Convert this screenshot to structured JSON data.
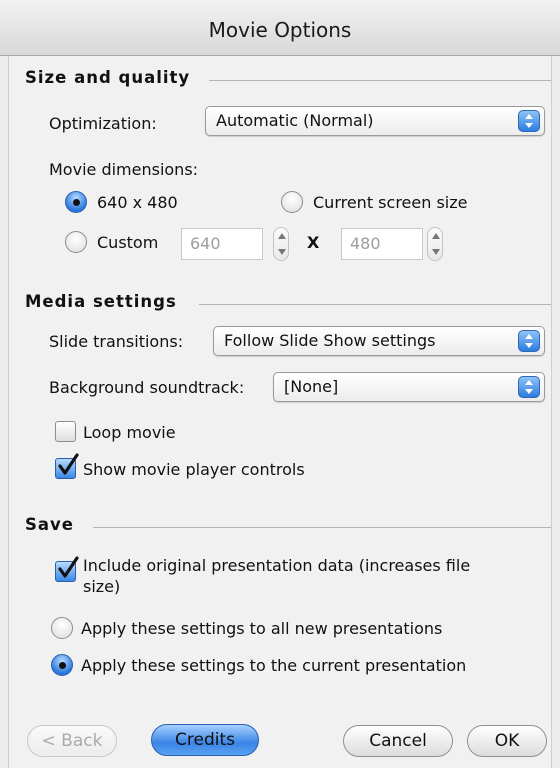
{
  "window": {
    "title": "Movie Options"
  },
  "size_quality": {
    "title": "Size and quality",
    "optimization_label": "Optimization:",
    "optimization_value": "Automatic (Normal)",
    "dimensions_label": "Movie dimensions:",
    "option_640": "640 x 480",
    "option_current": "Current screen size",
    "option_custom": "Custom",
    "custom_width": "640",
    "custom_x": "X",
    "custom_height": "480",
    "selected": "640 x 480"
  },
  "media": {
    "title": "Media settings",
    "transitions_label": "Slide transitions:",
    "transitions_value": "Follow Slide Show settings",
    "soundtrack_label": "Background soundtrack:",
    "soundtrack_value": "[None]",
    "loop_label": "Loop movie",
    "loop_checked": false,
    "controls_label": "Show movie player controls",
    "controls_checked": true
  },
  "save": {
    "title": "Save",
    "include_label_1": "Include original presentation data (increases file",
    "include_label_2": "size)",
    "include_checked": true,
    "apply_all_label": "Apply these settings to all new presentations",
    "apply_current_label": "Apply these settings to the current presentation",
    "selected": "Apply these settings to the current presentation"
  },
  "buttons": {
    "back": "< Back",
    "credits": "Credits",
    "cancel": "Cancel",
    "ok": "OK"
  },
  "colors": {
    "accent": "#3a85e6",
    "background": "#ececec"
  }
}
